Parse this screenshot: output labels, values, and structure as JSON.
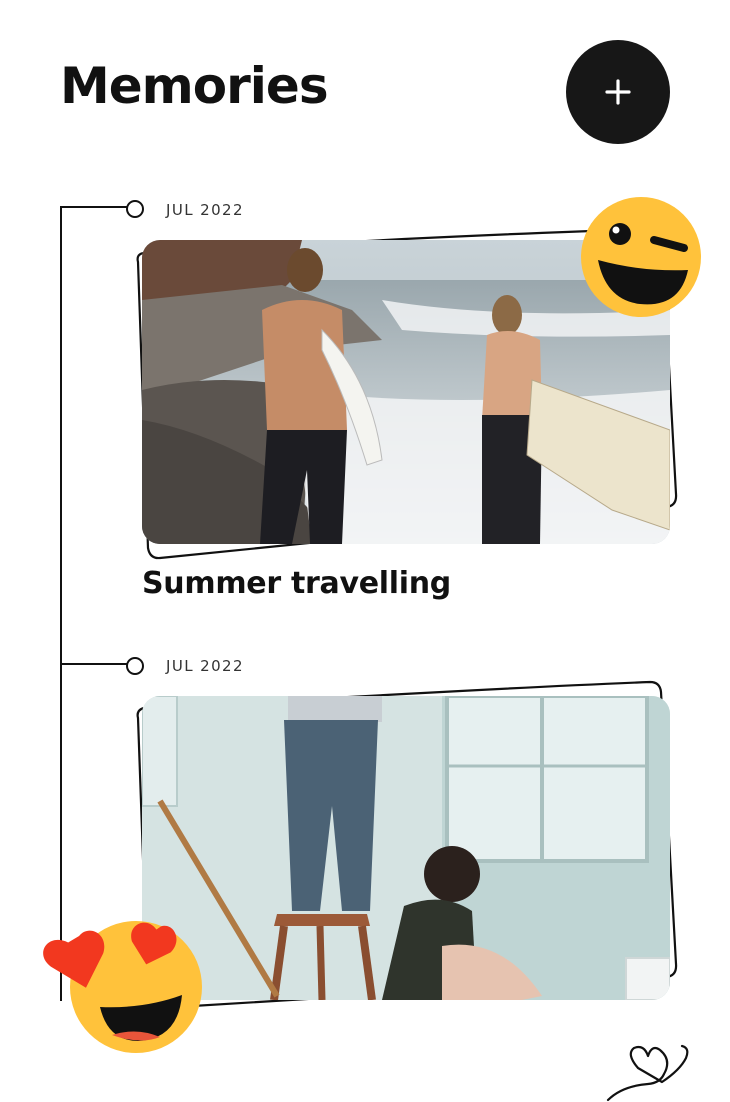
{
  "header": {
    "title": "Memories",
    "add_button_icon": "plus-icon"
  },
  "timeline": {
    "entries": [
      {
        "date": "JUL 2022",
        "title": "Summer travelling",
        "photo": "surfers-on-beach-photo",
        "sticker": "winking-face-icon"
      },
      {
        "date": "JUL 2022",
        "title": "",
        "photo": "painting-room-photo",
        "sticker": "heart-eyes-face-icon"
      }
    ]
  },
  "decorations": {
    "doodle": "heart-doodle-icon"
  },
  "colors": {
    "button_bg": "#171717",
    "sticker_yellow": "#FFC23B",
    "heart_red": "#F2381F"
  }
}
